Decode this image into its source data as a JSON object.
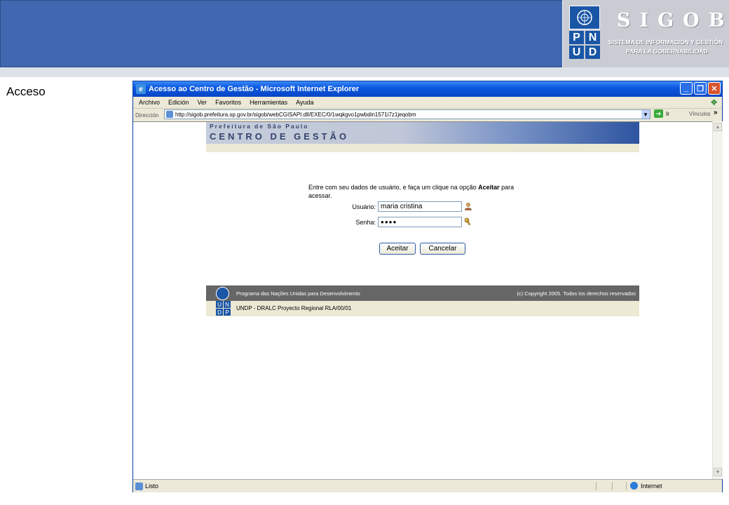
{
  "slide": {
    "section_title": "Acceso",
    "sigob_title": "SIGOB",
    "sigob_subtitle_1": "SISTEMA DE INFORMACIÓN Y GESTIÓN",
    "sigob_subtitle_2": "PARA LA GOBERNABILIDAD",
    "pnud_letters": [
      "P",
      "N",
      "U",
      "D"
    ]
  },
  "browser": {
    "window_title": "Acesso ao Centro de Gestão - Microsoft Internet Explorer",
    "menu": [
      "Archivo",
      "Edición",
      "Ver",
      "Favoritos",
      "Herramientas",
      "Ayuda"
    ],
    "address_label": "Dirección",
    "address_url": "http://sigob.prefeitura.sp.gov.br/sigob/webCGISAPI.dll/EXEC/0/1wqkgvo1pwbdin1571i7z1jeqobm",
    "go_label": "Ir",
    "links_label": "Vínculos",
    "status_text": "Listo",
    "zone_text": "Internet"
  },
  "page": {
    "header_line1": "Prefeitura de São Paulo",
    "header_line2": "CENTRO DE GESTÃO",
    "intro_part1": "Entre com seu dados de usuário, e faça um clique na opção ",
    "intro_bold": "Aceitar",
    "intro_part2": " para acessar.",
    "user_label": "Usuário:",
    "user_value": "maria cristina",
    "password_label": "Senha:",
    "password_value": "●●●●",
    "accept_button": "Aceitar",
    "cancel_button": "Cancelar",
    "footer_left": "Programa das Nações Unidas para Desenvolvimento",
    "footer_right": "(c) Copyright 2005. Todos los derechos reservados",
    "footer_project": "UNDP - DRALC Proyecto Regional RLA/00/01",
    "undp_letters": [
      "U",
      "N",
      "D",
      "P"
    ]
  }
}
